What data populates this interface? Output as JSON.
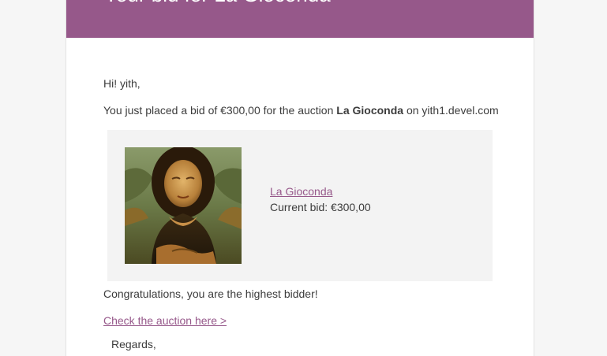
{
  "header": {
    "title": "Your bid for La Gioconda"
  },
  "greeting": "Hi! yith,",
  "intro": {
    "before": "You just placed a bid of €300,00 for the auction ",
    "auction_name": "La Gioconda",
    "after": " on yith1.devel.com"
  },
  "product": {
    "image_icon": "mona-lisa-painting",
    "name": "La Gioconda",
    "current_bid": "Current bid: €300,00"
  },
  "congrats": "Congratulations, you are the highest bidder!",
  "check_link": "Check the auction here >",
  "regards": "Regards,",
  "colors": {
    "brand": "#96588a",
    "background": "#f6f6f6",
    "card": "#f3f3f3"
  }
}
